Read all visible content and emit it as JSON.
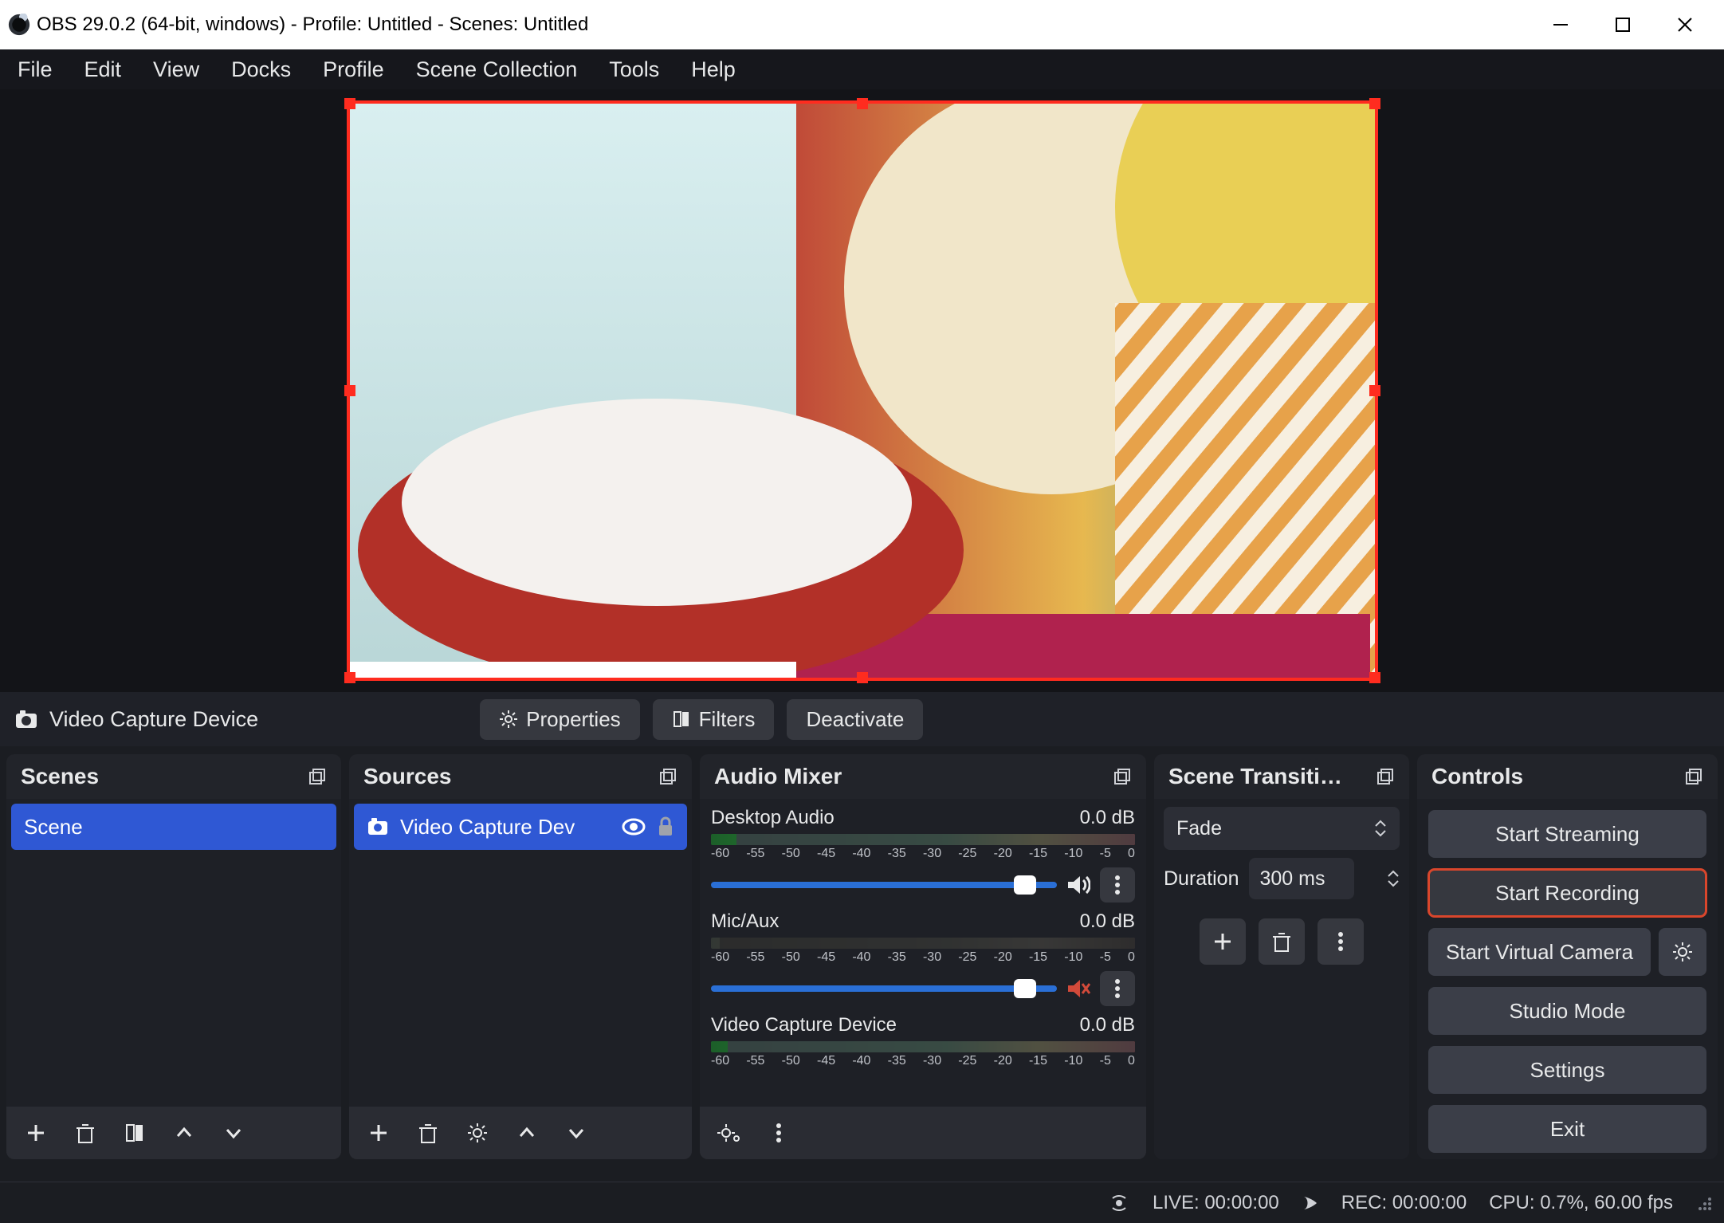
{
  "window": {
    "title": "OBS 29.0.2 (64-bit, windows) - Profile: Untitled - Scenes: Untitled"
  },
  "menu": [
    "File",
    "Edit",
    "View",
    "Docks",
    "Profile",
    "Scene Collection",
    "Tools",
    "Help"
  ],
  "source_bar": {
    "label": "Video Capture Device",
    "properties": "Properties",
    "filters": "Filters",
    "deactivate": "Deactivate"
  },
  "panels": {
    "scenes_title": "Scenes",
    "sources_title": "Sources",
    "mixer_title": "Audio Mixer",
    "transitions_title": "Scene Transiti…",
    "controls_title": "Controls"
  },
  "scenes": {
    "items": [
      {
        "label": "Scene"
      }
    ]
  },
  "sources": {
    "items": [
      {
        "label": "Video Capture Dev"
      }
    ]
  },
  "mixer": {
    "ticks": [
      "-60",
      "-55",
      "-50",
      "-45",
      "-40",
      "-35",
      "-30",
      "-25",
      "-20",
      "-15",
      "-10",
      "-5",
      "0"
    ],
    "channels": [
      {
        "name": "Desktop Audio",
        "db": "0.0 dB",
        "muted": false
      },
      {
        "name": "Mic/Aux",
        "db": "0.0 dB",
        "muted": true
      },
      {
        "name": "Video Capture Device",
        "db": "0.0 dB",
        "muted": false
      }
    ]
  },
  "transitions": {
    "selected": "Fade",
    "duration_label": "Duration",
    "duration_value": "300 ms"
  },
  "controls": {
    "start_streaming": "Start Streaming",
    "start_recording": "Start Recording",
    "start_virtual_camera": "Start Virtual Camera",
    "studio_mode": "Studio Mode",
    "settings": "Settings",
    "exit": "Exit"
  },
  "status": {
    "live": "LIVE: 00:00:00",
    "rec": "REC: 00:00:00",
    "cpu": "CPU: 0.7%, 60.00 fps"
  }
}
